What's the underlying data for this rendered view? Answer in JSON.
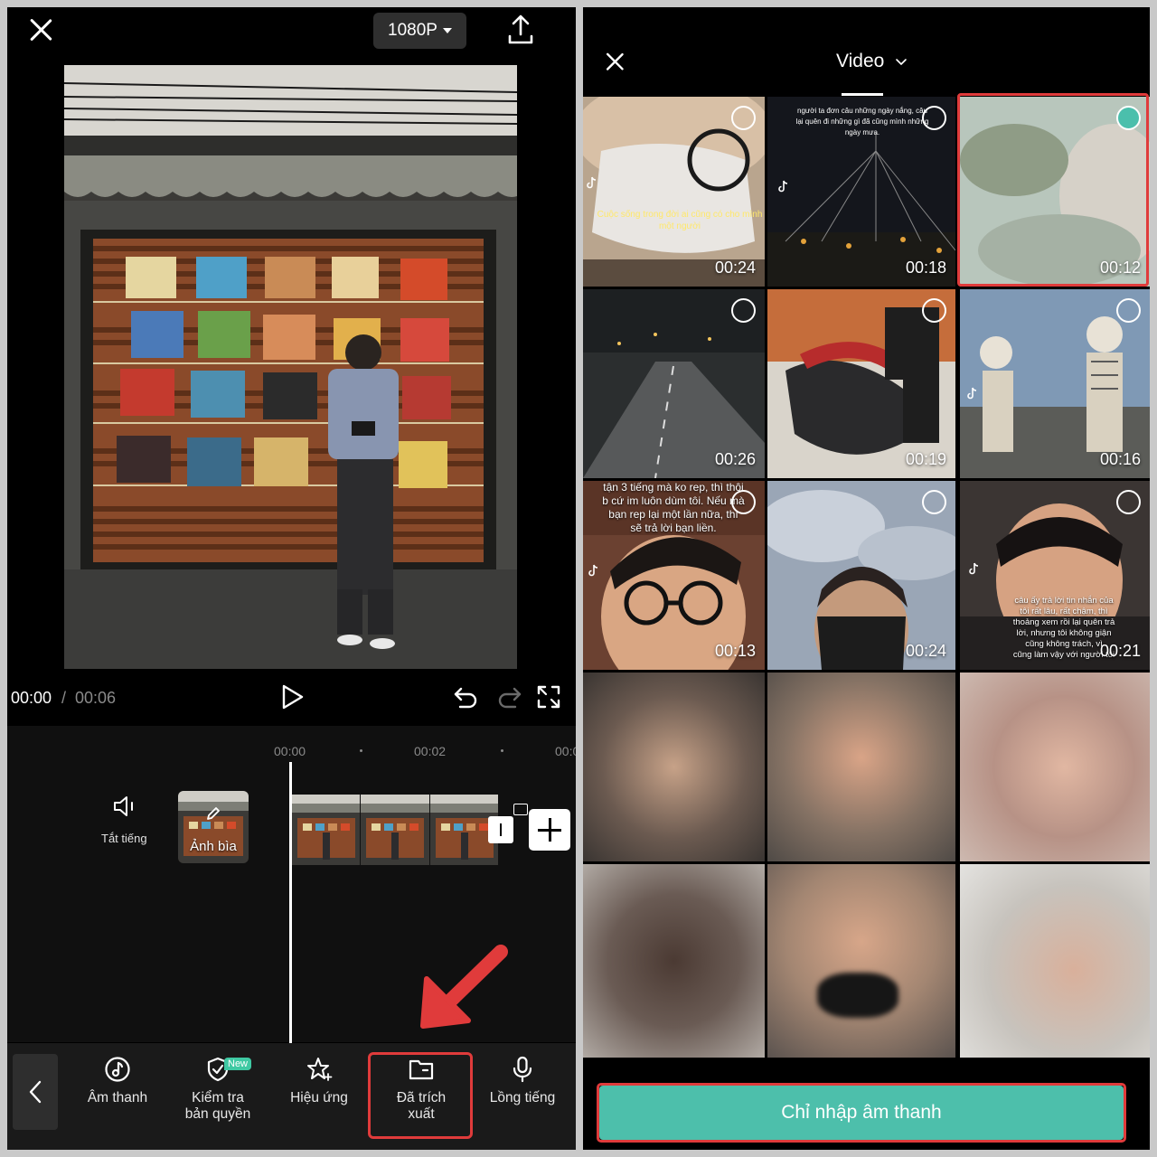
{
  "editor": {
    "resolution": "1080P",
    "time_current": "00:00",
    "time_separator": "/",
    "time_duration": "00:06",
    "timeline_ticks": [
      "00:00",
      "00:02",
      "00:0"
    ],
    "mute_label": "Tắt tiếng",
    "cover_label": "Ảnh bìa",
    "toolbar": [
      {
        "label": "Âm thanh",
        "icon": "music-note-icon"
      },
      {
        "label": "Kiểm tra\nbản quyền",
        "icon": "shield-check-icon"
      },
      {
        "label": "Hiệu ứng",
        "icon": "star-sparkle-icon"
      },
      {
        "label": "Đã trích\nxuất",
        "icon": "folder-icon"
      },
      {
        "label": "Lồng tiếng",
        "icon": "microphone-icon"
      }
    ],
    "new_badge": "New"
  },
  "picker": {
    "tab_label": "Video",
    "videos": [
      {
        "duration": "00:24",
        "selected": false,
        "caption": "Cuộc sống trong đời ai cũng có cho mình một người"
      },
      {
        "duration": "00:18",
        "selected": false,
        "caption": "người ta đơn câu những ngày nắng, câu lại quên đi những gì đã cũng mình những ngày mưa."
      },
      {
        "duration": "00:12",
        "selected": true,
        "caption": ""
      },
      {
        "duration": "00:26",
        "selected": false,
        "caption": ""
      },
      {
        "duration": "00:19",
        "selected": false,
        "caption": ""
      },
      {
        "duration": "00:16",
        "selected": false,
        "caption": ""
      },
      {
        "duration": "00:13",
        "selected": false,
        "caption": "tận 3 tiếng mà ko rep, thì thôi\nb cứ im luôn dùm tôi. Nếu mà\nbạn rep lại một lần nữa, thì\nsẽ trả lời bạn liền."
      },
      {
        "duration": "00:24",
        "selected": false,
        "caption": ""
      },
      {
        "duration": "00:21",
        "selected": false,
        "caption": "câu ấy trả lời tin nhắn của\ntôi rất lâu, rất chậm, thì\nthoảng xem rồi lại quên trả\nlời, nhưng tôi không giận\ncũng không trách, vì\ncũng làm vậy với người tôi"
      }
    ],
    "tiktok_label": "TikTok",
    "import_audio_label": "Chỉ nhập âm thanh"
  },
  "colors": {
    "accent": "#4dbfab",
    "highlight": "#e03b3b",
    "new_badge": "#3fc9a3"
  }
}
